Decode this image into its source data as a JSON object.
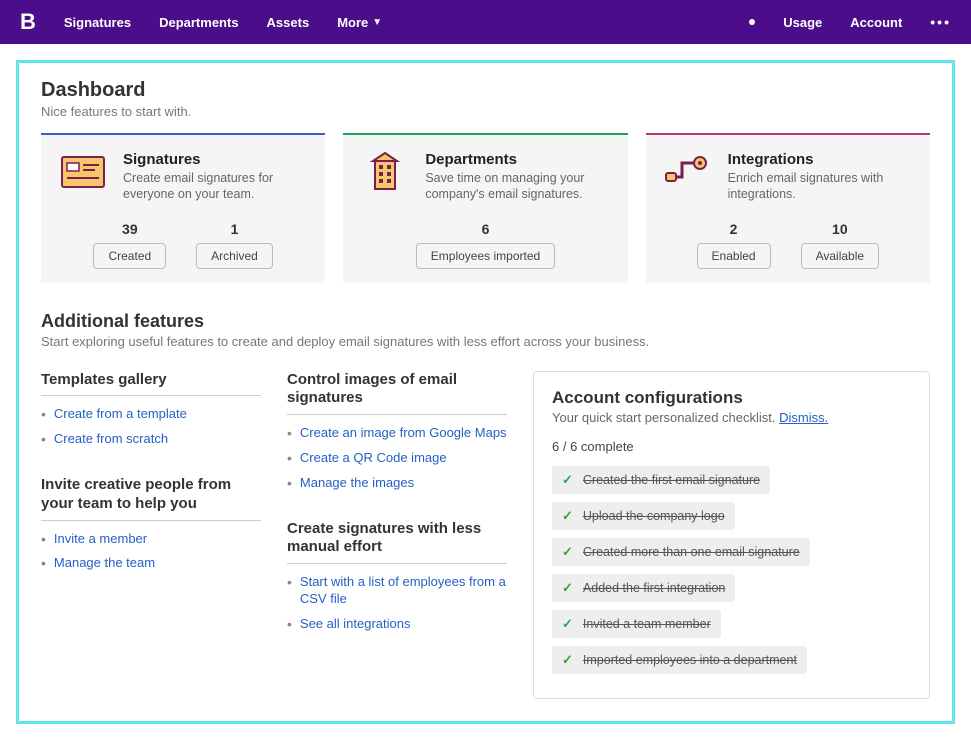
{
  "topbar": {
    "logo": "B",
    "nav": {
      "signatures": "Signatures",
      "departments": "Departments",
      "assets": "Assets",
      "more": "More"
    },
    "right": {
      "usage": "Usage",
      "account": "Account"
    }
  },
  "dashboard": {
    "title": "Dashboard",
    "subtitle": "Nice features to start with."
  },
  "cardSig": {
    "title": "Signatures",
    "desc": "Create email signatures for everyone on your team.",
    "stat1_val": "39",
    "stat1_label": "Created",
    "stat2_val": "1",
    "stat2_label": "Archived"
  },
  "cardDep": {
    "title": "Departments",
    "desc": "Save time on managing your company's email signatures.",
    "stat1_val": "6",
    "stat1_label": "Employees imported"
  },
  "cardInt": {
    "title": "Integrations",
    "desc": "Enrich email signatures with integrations.",
    "stat1_val": "2",
    "stat1_label": "Enabled",
    "stat2_val": "10",
    "stat2_label": "Available"
  },
  "additional": {
    "title": "Additional features",
    "subtitle": "Start exploring useful features to create and deploy email signatures with less effort across your business."
  },
  "templates": {
    "title": "Templates gallery",
    "link1": "Create from a template",
    "link2": "Create from scratch"
  },
  "images": {
    "title": "Control images of email signatures",
    "link1": "Create an image from Google Maps",
    "link2": "Create a QR Code image",
    "link3": "Manage the images"
  },
  "invite": {
    "title": "Invite creative people from your team to help you",
    "link1": "Invite a member",
    "link2": "Manage the team"
  },
  "lessEffort": {
    "title": "Create signatures with less manual effort",
    "link1": "Start with a list of employees from a CSV file",
    "link2": "See all integrations"
  },
  "config": {
    "title": "Account configurations",
    "subtitle": "Your quick start personalized checklist.",
    "dismiss": "Dismiss.",
    "countText": "6 / 6 complete",
    "items": [
      "Created the first email signature",
      "Upload the company logo",
      "Created more than one email signature",
      "Added the first integration",
      "Invited a team member",
      "Imported employees into a department"
    ]
  }
}
